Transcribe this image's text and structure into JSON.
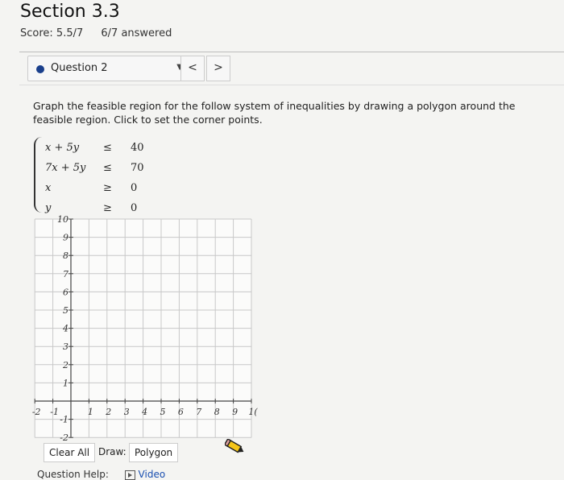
{
  "header": {
    "title": "Section 3.3",
    "score": "Score: 5.5/7",
    "answered": "6/7 answered"
  },
  "question_nav": {
    "selected": "Question 2",
    "caret_icon": "caret-down-icon",
    "prev_label": "<",
    "next_label": ">"
  },
  "question": {
    "prompt": "Graph the feasible region for the follow system of inequalities by drawing a polygon around the feasible region. Click to set the corner points.",
    "system": [
      {
        "lhs": "x + 5y",
        "op": "≤",
        "rhs": "40"
      },
      {
        "lhs": "7x + 5y",
        "op": "≤",
        "rhs": "70"
      },
      {
        "lhs": "x",
        "op": "≥",
        "rhs": "0"
      },
      {
        "lhs": "y",
        "op": "≥",
        "rhs": "0"
      }
    ]
  },
  "graph": {
    "x_ticks": [
      "-2",
      "-1",
      "1",
      "2",
      "3",
      "4",
      "5",
      "6",
      "7",
      "8",
      "9",
      "10"
    ],
    "y_ticks": [
      "10",
      "9",
      "8",
      "7",
      "6",
      "5",
      "4",
      "3",
      "2",
      "1",
      "-1",
      "-2"
    ],
    "x_last_label_display": "1(",
    "xlim": [
      -2,
      10
    ],
    "ylim": [
      -2,
      10
    ],
    "grid": true
  },
  "toolbar": {
    "clear_all": "Clear All",
    "draw_label": "Draw:",
    "polygon": "Polygon",
    "pencil_icon": "pencil-icon"
  },
  "help": {
    "label": "Question Help:",
    "video": "Video",
    "video_icon": "play-video-icon"
  }
}
